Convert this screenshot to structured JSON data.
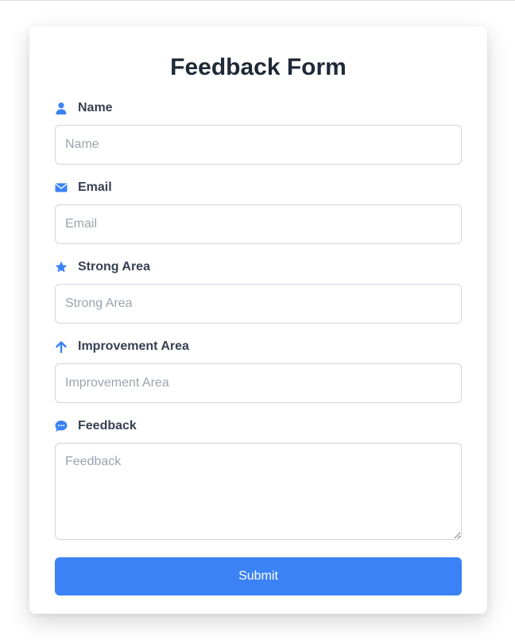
{
  "form": {
    "title": "Feedback Form",
    "accent_color": "#3b82f6",
    "fields": [
      {
        "icon": "user-icon",
        "label": "Name",
        "placeholder": "Name",
        "value": ""
      },
      {
        "icon": "envelope-icon",
        "label": "Email",
        "placeholder": "Email",
        "value": ""
      },
      {
        "icon": "star-icon",
        "label": "Strong Area",
        "placeholder": "Strong Area",
        "value": ""
      },
      {
        "icon": "arrow-up-icon",
        "label": "Improvement Area",
        "placeholder": "Improvement Area",
        "value": ""
      },
      {
        "icon": "comment-icon",
        "label": "Feedback",
        "placeholder": "Feedback",
        "value": ""
      }
    ],
    "submit_label": "Submit"
  }
}
